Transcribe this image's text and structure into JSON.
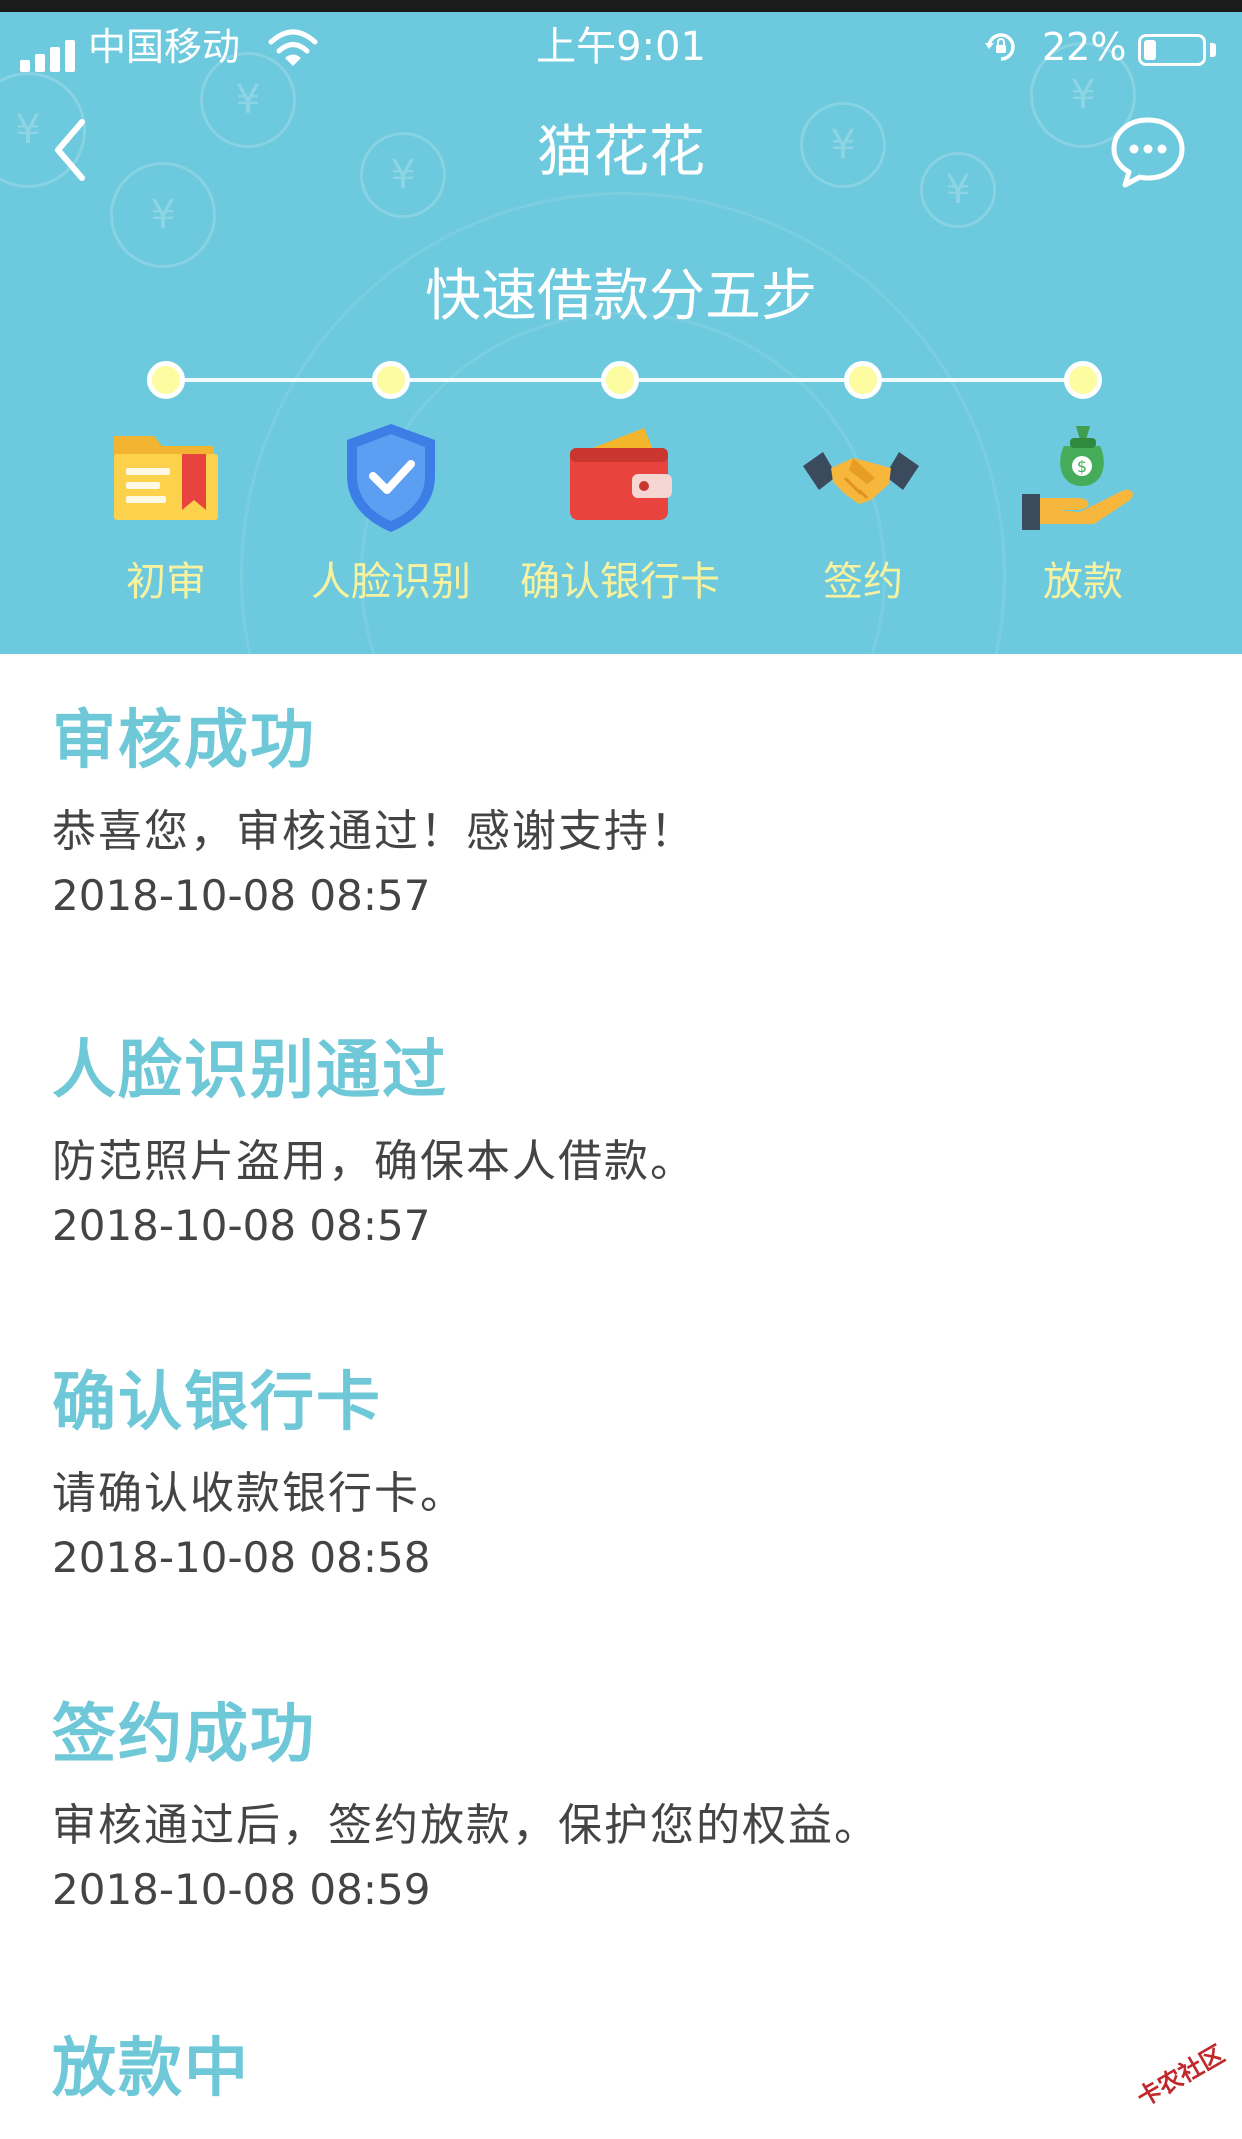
{
  "status_bar": {
    "carrier": "中国移动",
    "time": "上午9:01",
    "battery_percent": "22%",
    "battery_level": 0.22
  },
  "nav": {
    "title": "猫花花",
    "back_icon": "chevron-left-icon",
    "message_icon": "chat-bubble-icon"
  },
  "steps": {
    "title": "快速借款分五步",
    "items": [
      {
        "label": "初审",
        "icon": "folder-icon"
      },
      {
        "label": "人脸识别",
        "icon": "shield-check-icon"
      },
      {
        "label": "确认银行卡",
        "icon": "wallet-icon"
      },
      {
        "label": "签约",
        "icon": "handshake-icon"
      },
      {
        "label": "放款",
        "icon": "money-bag-icon"
      }
    ]
  },
  "timeline": [
    {
      "title": "审核成功",
      "desc": "恭喜您，审核通过！感谢支持！",
      "time": "2018-10-08 08:57"
    },
    {
      "title": "人脸识别通过",
      "desc": "防范照片盗用，确保本人借款。",
      "time": "2018-10-08 08:57"
    },
    {
      "title": "确认银行卡",
      "desc": "请确认收款银行卡。",
      "time": "2018-10-08 08:58"
    },
    {
      "title": "签约成功",
      "desc": "审核通过后，签约放款，保护您的权益。",
      "time": "2018-10-08 08:59"
    },
    {
      "title": "放款中",
      "desc": "",
      "time": ""
    }
  ],
  "watermark": "卡农社区",
  "colors": {
    "header_bg": "#6dc9dd",
    "title_accent": "#6ec8d7",
    "step_label": "#f6f2a0",
    "dot_fill": "#fdfca0"
  }
}
